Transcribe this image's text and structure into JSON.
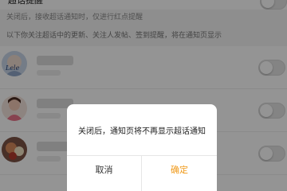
{
  "setting": {
    "title": "超话提醒",
    "hint": "关闭后，接收超话通知时，仅进行红点提醒",
    "list_note": "以下你关注超话中的更新、关注人发帖、签到提醒，将在通知页显示"
  },
  "list": {
    "items": [
      {
        "avatar": "avatar-lele",
        "avatar_text": "Lele"
      },
      {
        "avatar": "avatar-person"
      },
      {
        "avatar": "avatar-food"
      }
    ]
  },
  "dialog": {
    "message": "关闭后，通知页将不再显示超话通知",
    "cancel_label": "取消",
    "confirm_label": "确定",
    "confirm_color": "#f09a1a"
  }
}
